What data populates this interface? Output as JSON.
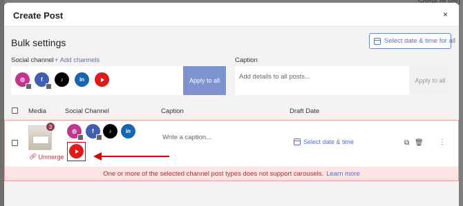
{
  "background": {
    "corner_text": "Some of you"
  },
  "modal": {
    "title": "Create Post",
    "close_label": "×"
  },
  "bulk": {
    "title": "Bulk settings",
    "date_button": "Select date & time for all",
    "social_channel_label": "Social channel",
    "add_channels": "+ Add channels",
    "apply_channels": "Apply to all",
    "caption_label": "Caption",
    "caption_placeholder": "Add details to all posts...",
    "apply_caption": "Apply to all",
    "channels": [
      "instagram",
      "facebook",
      "tiktok",
      "linkedin",
      "youtube"
    ]
  },
  "table": {
    "headers": [
      "Media",
      "Social Channel",
      "Caption",
      "Draft Date"
    ],
    "rows": [
      {
        "media_count": "3",
        "unmerge": "Unmerge",
        "caption_placeholder": "Write a caption...",
        "date": "Select date & time",
        "channels": [
          "instagram",
          "facebook",
          "tiktok",
          "linkedin",
          "youtube"
        ]
      }
    ]
  },
  "warning": {
    "text": "One or more of the selected channel post types does not support carousels.",
    "link": "Learn more"
  },
  "icons": {
    "instagram": "instagram-icon",
    "facebook": "facebook-icon",
    "tiktok": "tiktok-icon",
    "linkedin": "linkedin-icon",
    "youtube": "youtube-icon",
    "calendar": "calendar-icon",
    "copy": "copy-icon",
    "trash": "trash-icon",
    "drag": "drag-handle-icon",
    "link": "link-icon"
  },
  "colors": {
    "accent": "#5a6fb7",
    "apply_button": "#7f93cf",
    "instagram": "#c1358f",
    "facebook": "#3e5fb3",
    "tiktok": "#000000",
    "linkedin": "#1767b0",
    "youtube": "#e01a1a",
    "warning_bg": "#fbe4e3",
    "warning_text": "#a03030",
    "highlight": "#d80000"
  }
}
